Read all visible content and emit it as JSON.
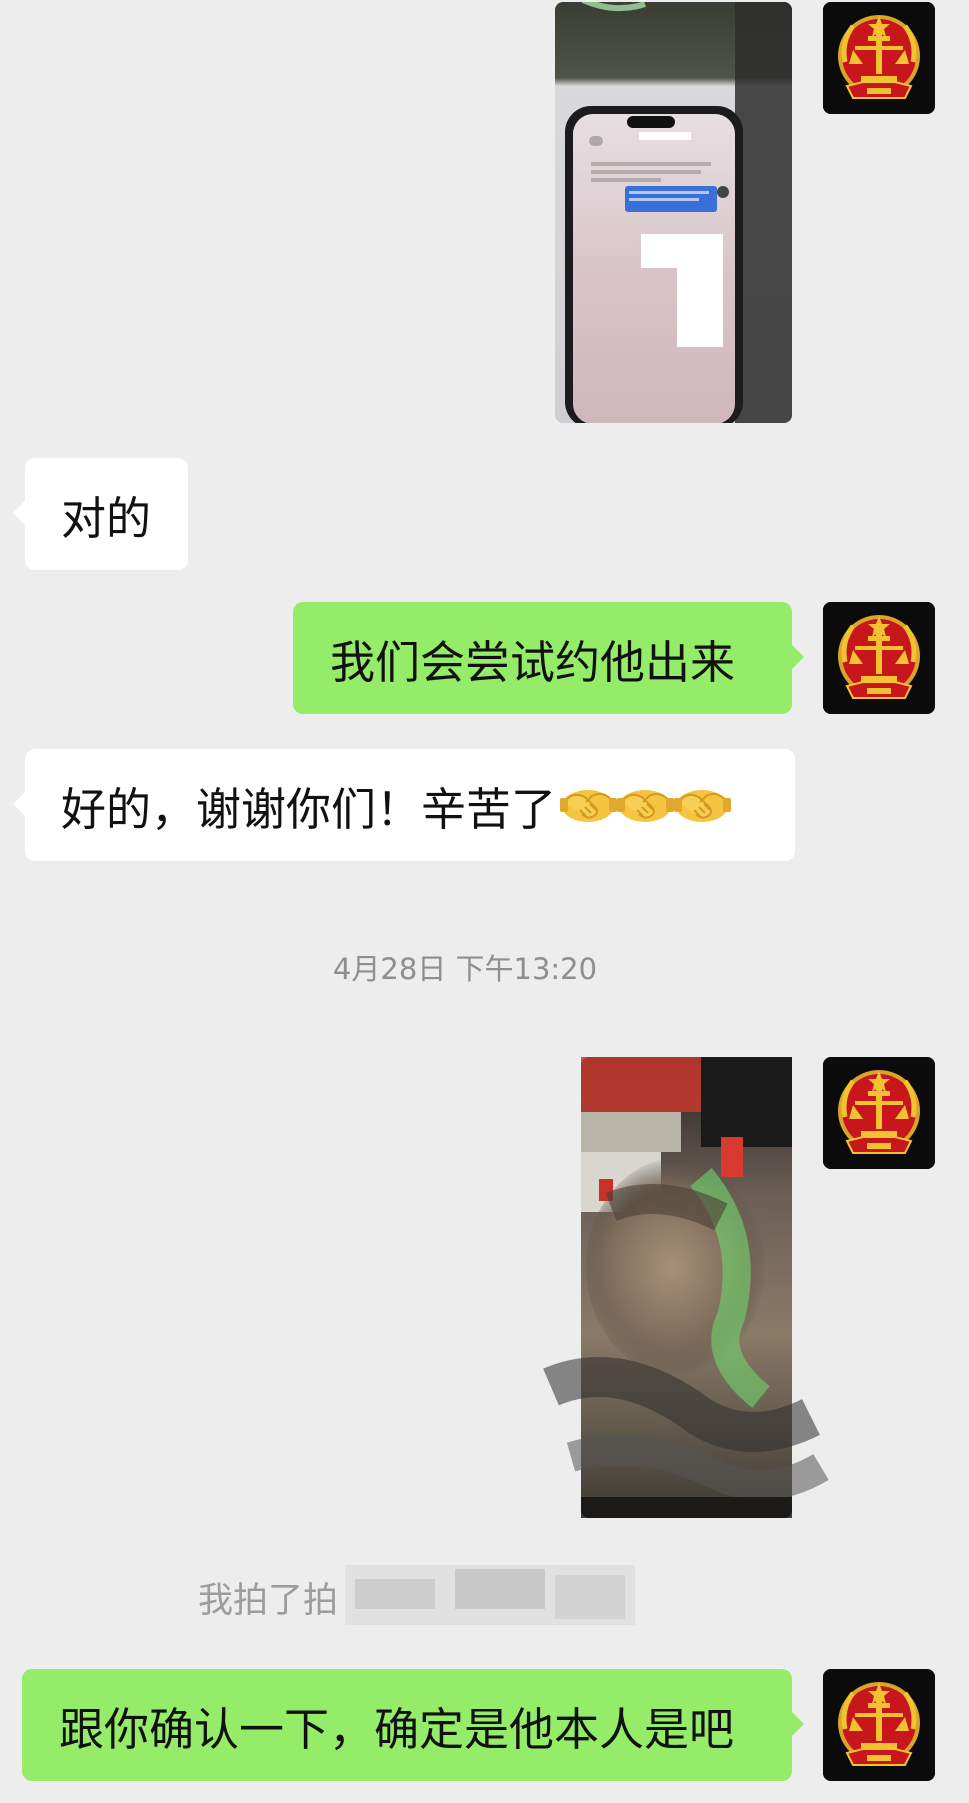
{
  "messages": {
    "m1_text": "对的",
    "m2_text": "我们会尝试约他出来",
    "m3_text": "好的，谢谢你们！辛苦了",
    "m3_emojis": [
      "handshake",
      "handshake",
      "handshake"
    ],
    "timestamp": "4月28日 下午13:20",
    "pat_text": "我拍了拍",
    "m4_text": "跟你确认一下，确定是他本人是吧"
  },
  "icons": {
    "avatar": "court-emblem-icon",
    "emoji": "handshake-emoji-icon"
  },
  "colors": {
    "background": "#ededed",
    "sent_bubble": "#95ec69",
    "received_bubble": "#ffffff",
    "emblem_red": "#c8161d",
    "emblem_gold": "#f2c230"
  }
}
